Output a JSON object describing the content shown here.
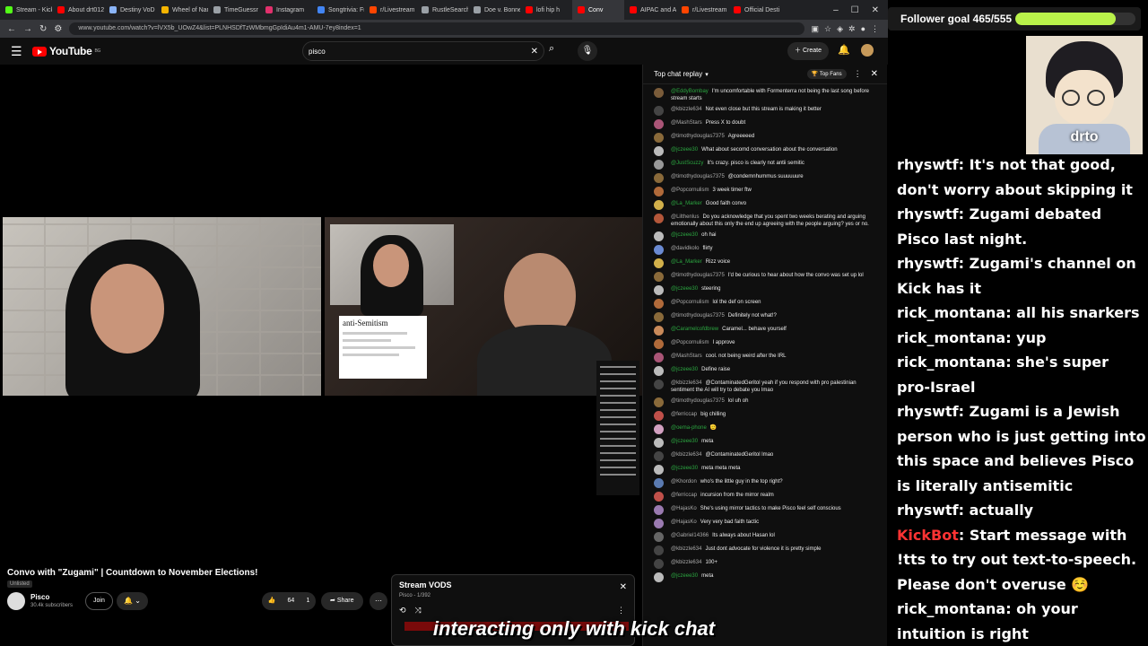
{
  "browser": {
    "tabs": [
      {
        "label": "Stream - Kick",
        "color": "#53fc18",
        "active": false
      },
      {
        "label": "About drt0123",
        "color": "#ff0000",
        "active": false
      },
      {
        "label": "Destiny VoD",
        "color": "#8ab4f8",
        "active": false
      },
      {
        "label": "Wheel of Names",
        "color": "#f4b400",
        "active": false
      },
      {
        "label": "TimeGuessr",
        "color": "#9aa0a6",
        "active": false
      },
      {
        "label": "Instagram",
        "color": "#e1306c",
        "active": false
      },
      {
        "label": "Songtrivia: Fr",
        "color": "#4285f4",
        "active": false
      },
      {
        "label": "r/Livestream",
        "color": "#ff4500",
        "active": false
      },
      {
        "label": "RustleSearch",
        "color": "#9aa0a6",
        "active": false
      },
      {
        "label": "Doe v. Bonne",
        "color": "#9aa0a6",
        "active": false
      },
      {
        "label": "lofi hip h",
        "color": "#ff0000",
        "active": false
      },
      {
        "label": "Conv",
        "color": "#ff0000",
        "active": true
      },
      {
        "label": "AIPAC and A",
        "color": "#ff0000",
        "active": false
      },
      {
        "label": "r/Livestream",
        "color": "#ff4500",
        "active": false
      },
      {
        "label": "Official Desti",
        "color": "#ff0000",
        "active": false
      }
    ],
    "url": "www.youtube.com/watch?v=lVX5b_UOwZ4&list=PLNHSDfTzWMbmgGpIdiAu4m1-AMU-7ey8index=1"
  },
  "youtube": {
    "logo_text": "YouTube",
    "logo_region": "BG",
    "search_value": "pisco",
    "create_label": "Create"
  },
  "video": {
    "doc_heading": "anti-Semitism"
  },
  "meta": {
    "title": "Convo with \"Zugami\" | Countdown to November Elections!",
    "unlisted": "Unlisted",
    "channel": "Pisco",
    "subscribers": "30.4k subscribers",
    "join_label": "Join",
    "likes": "64",
    "dislikes": "1",
    "share_label": "Share"
  },
  "playlist": {
    "title": "Stream VODS",
    "subtitle": "Pisco - 1/392"
  },
  "chat": {
    "header": "Top chat replay",
    "top_fans": "Top Fans",
    "messages": [
      {
        "author": "@EddyBombay",
        "text": "I'm uncomfortable with Formenterra not being the last song before stream starts",
        "member": true,
        "avatar": "#7a5c3a"
      },
      {
        "author": "@kbizzle634",
        "text": "Not even close but this stream is making it better",
        "member": false,
        "avatar": "#444"
      },
      {
        "author": "@MashStars",
        "text": "Press X to doubt",
        "member": false,
        "avatar": "#aa5577"
      },
      {
        "author": "@timothydouglas7375",
        "text": "Agreeeeed",
        "member": false,
        "avatar": "#8a6a3a"
      },
      {
        "author": "@jczeee30",
        "text": "What about secomd conversation about the conversation",
        "member": true,
        "avatar": "#bbb"
      },
      {
        "author": "@JustScuzzy",
        "text": "It's crazy. pisco is clearly not antii semitic",
        "member": true,
        "avatar": "#999"
      },
      {
        "author": "@timothydouglas7375",
        "text": "@condemnhummus suuuuuure",
        "member": false,
        "avatar": "#8a6a3a"
      },
      {
        "author": "@Popcornulism",
        "text": "3 week timer ftw",
        "member": false,
        "avatar": "#b06a3a"
      },
      {
        "author": "@La_Marker",
        "text": "Good faith convo",
        "member": true,
        "avatar": "#d2b04a"
      },
      {
        "author": "@Lilthenlus",
        "text": "Do you acknowledge that you spent two weeks berating and arguing emotionally about this only the end up agreeing with the people arguing? yes or no.",
        "member": false,
        "avatar": "#b4573a"
      },
      {
        "author": "@jczeee30",
        "text": "oh hai",
        "member": true,
        "avatar": "#bbb"
      },
      {
        "author": "@davidkolo",
        "text": "flirty",
        "member": false,
        "avatar": "#6a8ad2"
      },
      {
        "author": "@La_Marker",
        "text": "Rizz voice",
        "member": true,
        "avatar": "#d2b04a"
      },
      {
        "author": "@timothydouglas7375",
        "text": "I'd be curious to hear about how the convo was set up lol",
        "member": false,
        "avatar": "#8a6a3a"
      },
      {
        "author": "@jczeee30",
        "text": "steering",
        "member": true,
        "avatar": "#bbb"
      },
      {
        "author": "@Popcornulism",
        "text": "lol the def on screen",
        "member": false,
        "avatar": "#b06a3a"
      },
      {
        "author": "@timothydouglas7375",
        "text": "Definitely not what!?",
        "member": false,
        "avatar": "#8a6a3a"
      },
      {
        "author": "@Caramelcofdbrew",
        "text": "Caramel... behave yourself",
        "member": true,
        "avatar": "#c98a5a"
      },
      {
        "author": "@Popcornulism",
        "text": "I approve",
        "member": false,
        "avatar": "#b06a3a"
      },
      {
        "author": "@MashStars",
        "text": "cool. not being weird after the IRL",
        "member": false,
        "avatar": "#aa5577"
      },
      {
        "author": "@jczeee30",
        "text": "Define raise",
        "member": true,
        "avatar": "#bbb"
      },
      {
        "author": "@kbizzle634",
        "text": "@ContaminatedGeritol yeah if you respond with pro palestinian sentiment the AI will try to debate you lmao",
        "member": false,
        "avatar": "#444"
      },
      {
        "author": "@timothydouglas7375",
        "text": "lol uh oh",
        "member": false,
        "avatar": "#8a6a3a"
      },
      {
        "author": "@ferriccap",
        "text": "big chilling",
        "member": false,
        "avatar": "#c0504a"
      },
      {
        "author": "@oema-phone",
        "text": "🫡",
        "member": true,
        "avatar": "#d2a0c0"
      },
      {
        "author": "@jczeee30",
        "text": "meta",
        "member": true,
        "avatar": "#bbb"
      },
      {
        "author": "@kbizzle634",
        "text": "@ContaminatedGeritol lmao",
        "member": false,
        "avatar": "#444"
      },
      {
        "author": "@jczeee30",
        "text": "meta meta meta",
        "member": true,
        "avatar": "#bbb"
      },
      {
        "author": "@Khordon",
        "text": "who's the little guy in the top right?",
        "member": false,
        "avatar": "#5a7ab0"
      },
      {
        "author": "@ferriccap",
        "text": "incursion from the mirror realm",
        "member": false,
        "avatar": "#c0504a"
      },
      {
        "author": "@HajasKo",
        "text": "She's using mirror tactics to make Pisco feel self conscious",
        "member": false,
        "avatar": "#9a7ab0"
      },
      {
        "author": "@HajasKo",
        "text": "Very very bad faith tactic",
        "member": false,
        "avatar": "#9a7ab0"
      },
      {
        "author": "@Gabriel14366",
        "text": "Its always about Hasan lol",
        "member": false,
        "avatar": "#666"
      },
      {
        "author": "@kbizzle634",
        "text": "Just dont advocate for violence it is pretty simple",
        "member": false,
        "avatar": "#444"
      },
      {
        "author": "@kbizzle634",
        "text": "100+",
        "member": false,
        "avatar": "#444"
      },
      {
        "author": "@jczeee30",
        "text": "meta",
        "member": true,
        "avatar": "#bbb"
      }
    ]
  },
  "overlay": {
    "goal_label": "Follower goal 465/555",
    "goal_progress": 0.838,
    "streamer_name": "drto",
    "kick_lines": [
      {
        "user": "rhyswtf",
        "text": "It's not that good, don't worry about skipping it",
        "bot": false
      },
      {
        "user": "rhyswtf",
        "text": "Zugami debated Pisco last night.",
        "bot": false
      },
      {
        "user": "rhyswtf",
        "text": "Zugami's channel on Kick has it",
        "bot": false
      },
      {
        "user": "rick_montana",
        "text": "all his snarkers",
        "bot": false
      },
      {
        "user": "rick_montana",
        "text": "yup",
        "bot": false
      },
      {
        "user": "rick_montana",
        "text": "she's super pro-Israel",
        "bot": false
      },
      {
        "user": "rhyswtf",
        "text": "Zugami is a Jewish person who is just getting into this space and believes Pisco is literally antisemitic",
        "bot": false
      },
      {
        "user": "rhyswtf",
        "text": "actually",
        "bot": false
      },
      {
        "user": "KickBot",
        "text": "Start message with !tts to try out text-to-speech. Please don't overuse ☺️",
        "bot": true
      },
      {
        "user": "rick_montana",
        "text": "oh your intuition is right",
        "bot": false
      }
    ]
  },
  "caption": "interacting only with kick chat"
}
